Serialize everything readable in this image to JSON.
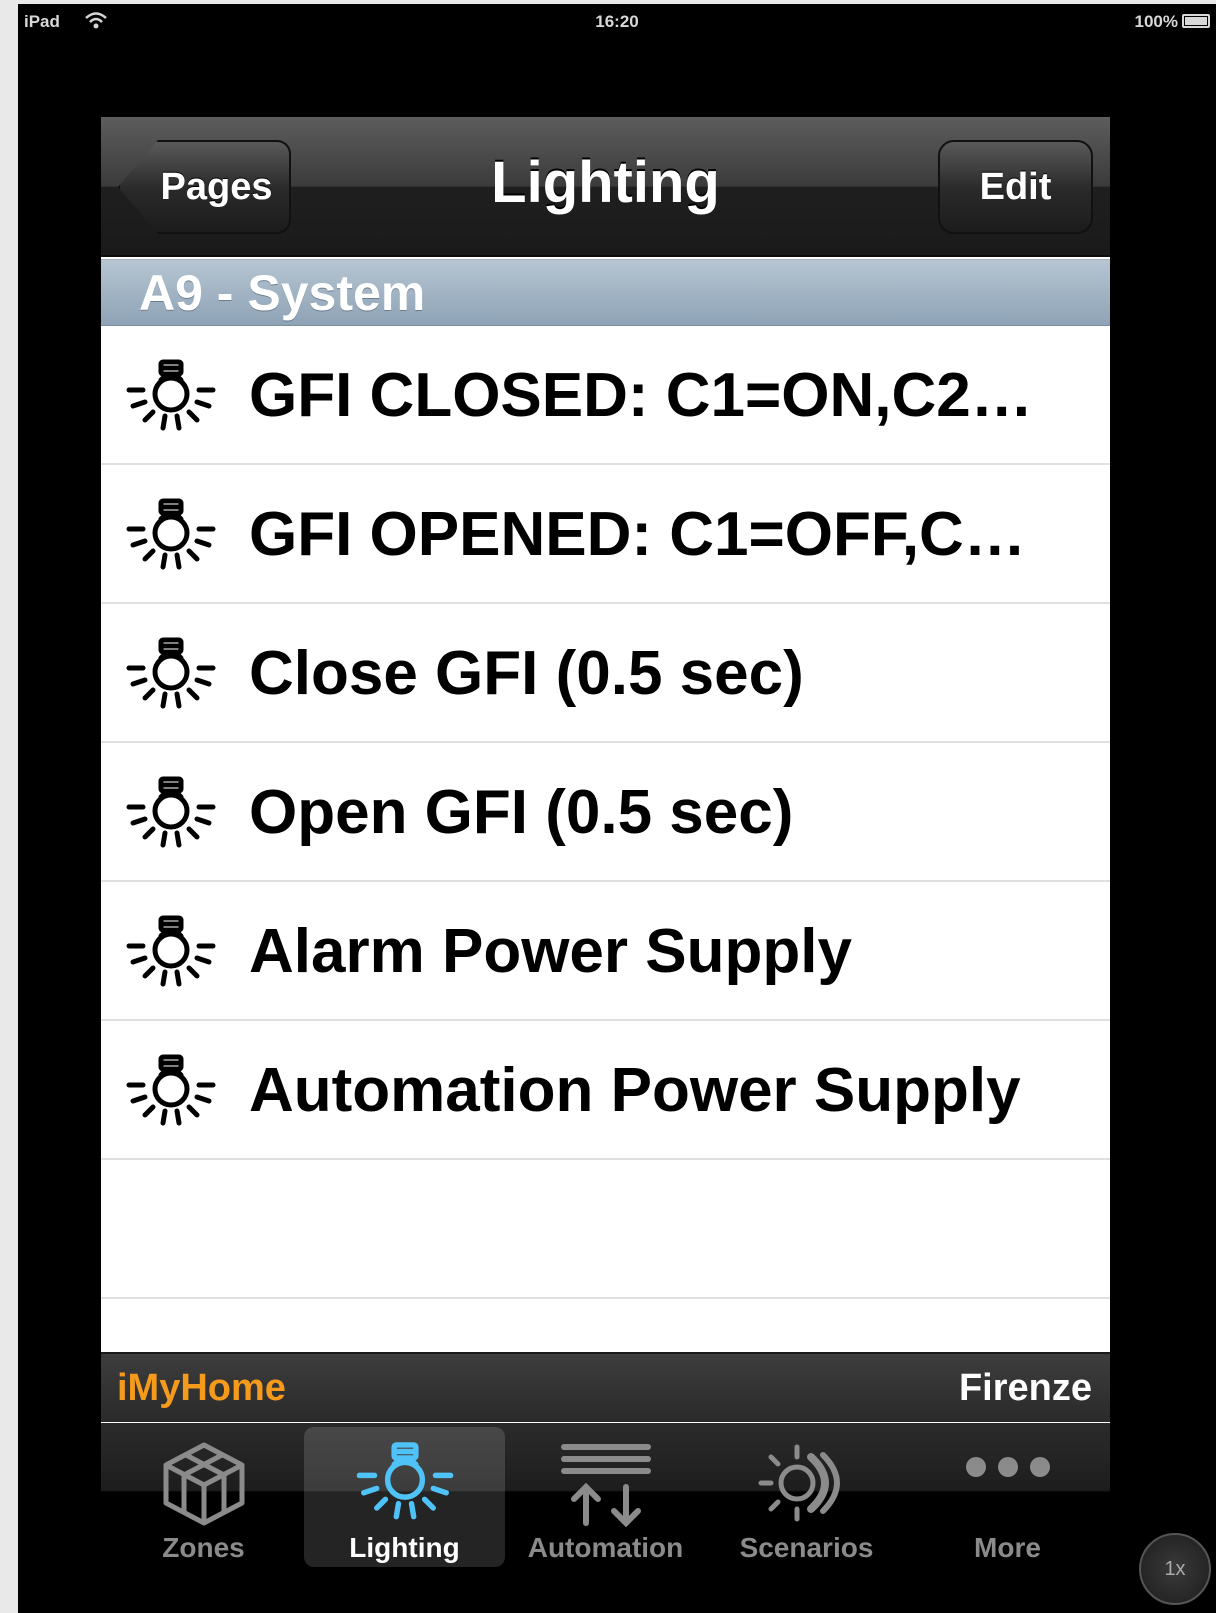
{
  "status_bar": {
    "device": "iPad",
    "time": "16:20",
    "battery": "100%"
  },
  "nav": {
    "back_label": "Pages",
    "title": "Lighting",
    "edit_label": "Edit"
  },
  "section": {
    "title": "A9 - System"
  },
  "items": [
    {
      "label": "GFI CLOSED: C1=ON,C2…",
      "icon": "light-bulb-icon"
    },
    {
      "label": "GFI OPENED: C1=OFF,C…",
      "icon": "light-bulb-icon"
    },
    {
      "label": "Close GFI (0.5 sec)",
      "icon": "light-bulb-icon"
    },
    {
      "label": "Open GFI (0.5 sec)",
      "icon": "light-bulb-icon"
    },
    {
      "label": "Alarm Power Supply",
      "icon": "light-bulb-icon"
    },
    {
      "label": "Automation Power Supply",
      "icon": "light-bulb-icon"
    }
  ],
  "footer": {
    "brand": "iMyHome",
    "location": "Firenze"
  },
  "tabs": [
    {
      "label": "Zones",
      "icon": "cube-icon",
      "selected": false
    },
    {
      "label": "Lighting",
      "icon": "light-bulb-icon",
      "selected": true
    },
    {
      "label": "Automation",
      "icon": "shutter-arrows-icon",
      "selected": false
    },
    {
      "label": "Scenarios",
      "icon": "sun-moon-icon",
      "selected": false
    },
    {
      "label": "More",
      "icon": "more-dots-icon",
      "selected": false
    }
  ],
  "zoom": {
    "label": "1x"
  },
  "colors": {
    "brand": "#f59a1b",
    "selected_icon": "#4fc3f7",
    "section_header": "#9fb2c3"
  }
}
